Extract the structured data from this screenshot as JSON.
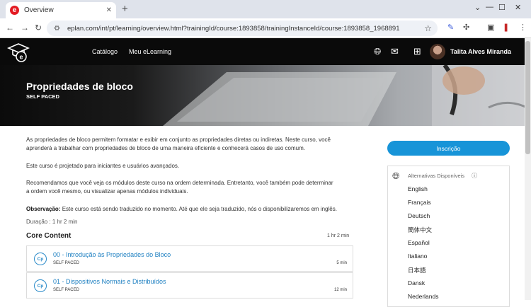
{
  "browser": {
    "tab_title": "Overview",
    "tab_favicon": "e",
    "url": "eplan.com/int/pt/learning/overview.html?trainingId/course:1893858/trainingInstanceId/course:1893858_1968891"
  },
  "header": {
    "nav": [
      "Catálogo",
      "Meu eLearning"
    ],
    "user_name": "Talita Alves Miranda",
    "logo_letter": "e"
  },
  "hero": {
    "title": "Propriedades de bloco",
    "subtitle": "SELF PACED"
  },
  "description": {
    "p1": "As propriedades de bloco permitem formatar e exibir em conjunto as propriedades diretas ou indiretas. Neste curso, você aprenderá a trabalhar com propriedades de bloco de uma maneira eficiente e conhecerá casos de uso comum.",
    "p2": "Este curso é projetado para iniciantes e usuários avançados.",
    "p3": "Recomendamos que você veja os módulos deste curso na ordem determinada. Entretanto, você também pode determinar a ordem você mesmo, ou visualizar apenas módulos individuais.",
    "note_label": "Observação:",
    "note_text": " Este curso está sendo traduzido no momento. Até que ele seja traduzido, nós o disponibilizaremos em inglês.",
    "duration": "Duração : 1 hr 2 min"
  },
  "core": {
    "title": "Core Content",
    "total_time": "1 hr 2 min",
    "modules": [
      {
        "badge": "Cp",
        "title": "00 - Introdução às Propriedades do Bloco",
        "type": "SELF PACED",
        "time": "5 min"
      },
      {
        "badge": "Cp",
        "title": "01 - Dispositivos Normais e Distribuídos",
        "type": "SELF PACED",
        "time": "12 min"
      }
    ]
  },
  "sidebar": {
    "enroll_label": "Inscrição",
    "alt_title": "Alternativas Disponíveis",
    "languages": [
      "English",
      "Français",
      "Deutsch",
      "簡体中文",
      "Español",
      "Italiano",
      "日本語",
      "Dansk",
      "Nederlands"
    ]
  },
  "colors": {
    "accent": "#1794d8",
    "link": "#1c7fc1",
    "header_bg": "#0a0a0a"
  }
}
